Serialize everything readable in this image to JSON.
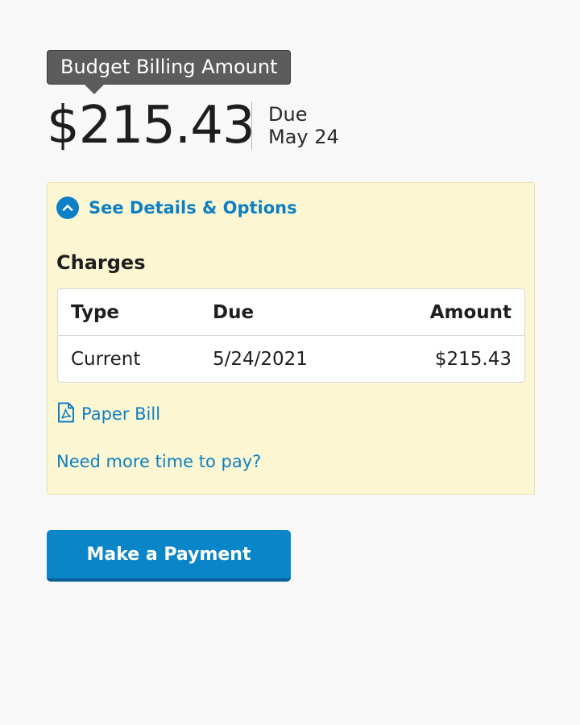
{
  "summary": {
    "tooltip_label": "Budget Billing Amount",
    "amount": "$215.43",
    "due_label": "Due",
    "due_date": "May 24"
  },
  "details": {
    "toggle_label": "See Details & Options",
    "charges_heading": "Charges",
    "table": {
      "columns": [
        "Type",
        "Due",
        "Amount"
      ],
      "rows": [
        [
          "Current",
          "5/24/2021",
          "$215.43"
        ]
      ]
    },
    "paper_bill_label": "Paper Bill",
    "more_time_link": "Need more time to pay?"
  },
  "actions": {
    "make_payment_label": "Make a Payment"
  },
  "icons": {
    "toggle": "chevron-up-icon",
    "paper_bill": "pdf-icon"
  },
  "colors": {
    "link": "#0d7fc4",
    "button": "#0a86c8",
    "panel_background": "#fcf7d2",
    "tooltip_background": "#5c5c5c"
  }
}
